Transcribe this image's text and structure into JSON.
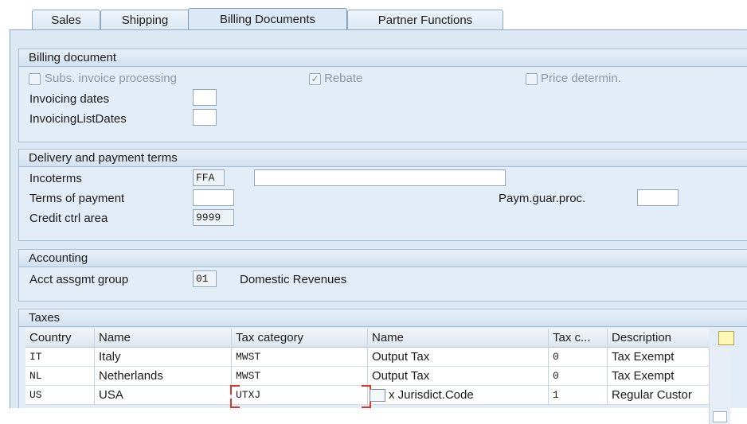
{
  "tabs": [
    {
      "label": "Sales",
      "active": false
    },
    {
      "label": "Shipping",
      "active": false
    },
    {
      "label": "Billing Documents",
      "active": true
    },
    {
      "label": "Partner Functions",
      "active": false
    }
  ],
  "billing": {
    "title": "Billing document",
    "subs_invoice": "Subs. invoice processing",
    "rebate": "Rebate",
    "price_determin": "Price determin.",
    "invoicing_dates": "Invoicing dates",
    "invoicing_dates_value": "",
    "invoicing_list_dates": "InvoicingListDates",
    "invoicing_list_dates_value": ""
  },
  "delivery": {
    "title": "Delivery and payment terms",
    "incoterms_label": "Incoterms",
    "incoterms_value": "FFA",
    "incoterms_desc": "",
    "terms_payment_label": "Terms of payment",
    "terms_payment_value": "",
    "paym_guar_label": "Paym.guar.proc.",
    "paym_guar_value": "",
    "credit_ctrl_label": "Credit ctrl area",
    "credit_ctrl_value": "9999"
  },
  "accounting": {
    "title": "Accounting",
    "acct_label": "Acct assgmt group",
    "acct_value": "01",
    "acct_desc": "Domestic Revenues"
  },
  "taxes": {
    "title": "Taxes",
    "columns": [
      "Country",
      "Name",
      "Tax category",
      "Name",
      "Tax c...",
      "Description"
    ],
    "rows": [
      {
        "country": "IT",
        "name": "Italy",
        "tax_category": "MWST",
        "tax_name": "Output Tax",
        "tax_class": "0",
        "description": "Tax Exempt"
      },
      {
        "country": "NL",
        "name": "Netherlands",
        "tax_category": "MWST",
        "tax_name": "Output Tax",
        "tax_class": "0",
        "description": "Tax Exempt"
      },
      {
        "country": "US",
        "name": "USA",
        "tax_category": "UTXJ",
        "tax_name": "x Jurisdict.Code",
        "tax_class": "1",
        "description": "Regular Custor"
      }
    ]
  }
}
